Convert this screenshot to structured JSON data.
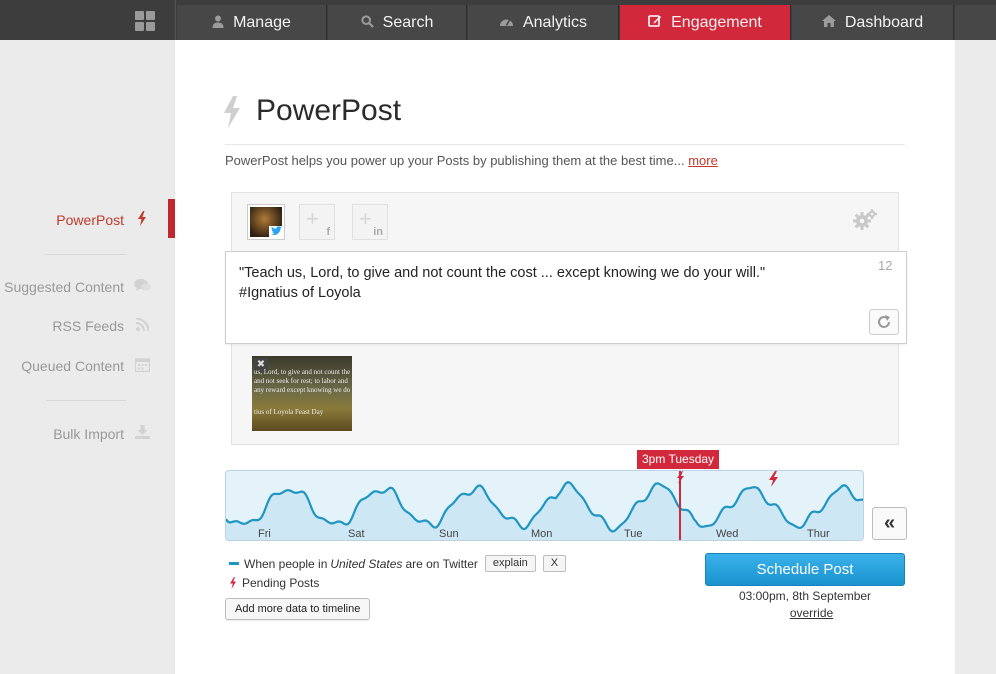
{
  "nav": {
    "tabs": [
      {
        "label": "Manage",
        "icon": "user-icon"
      },
      {
        "label": "Search",
        "icon": "search-icon"
      },
      {
        "label": "Analytics",
        "icon": "dashboard-gauge-icon"
      },
      {
        "label": "Engagement",
        "icon": "edit-icon",
        "active": true
      },
      {
        "label": "Dashboard",
        "icon": "home-icon"
      }
    ],
    "active_color": "#d2283b"
  },
  "sidebar": {
    "items": [
      {
        "label": "PowerPost",
        "icon": "bolt-icon",
        "active": true
      },
      {
        "label": "Suggested Content",
        "icon": "comments-icon"
      },
      {
        "label": "RSS Feeds",
        "icon": "rss-icon"
      },
      {
        "label": "Queued Content",
        "icon": "calendar-icon"
      },
      {
        "label": "Bulk Import",
        "icon": "download-icon"
      }
    ]
  },
  "page": {
    "title": "PowerPost",
    "intro": "PowerPost helps you power up your Posts by publishing them at the best time...",
    "more_link": "more"
  },
  "composer": {
    "networks": [
      {
        "label": "f",
        "icon": "facebook-add-icon"
      },
      {
        "label": "in",
        "icon": "linkedin-add-icon"
      }
    ],
    "text_line1": "\"Teach us, Lord, to give and not count the cost ... except knowing we do your will.\"",
    "text_line2": "#Ignatius of Loyola",
    "char_count": "12",
    "image_caption_lines": [
      "us, Lord, to give and not count the",
      "and not seek for rest; to labor and",
      "any reward except knowing we do",
      "",
      "tius of Loyola Feast Day"
    ]
  },
  "timeline": {
    "days": [
      "Fri",
      "Sat",
      "Sun",
      "Mon",
      "Tue",
      "Wed",
      "Thur"
    ],
    "now_label": "3pm Tuesday",
    "line_color": "#1f96c2",
    "marker_color": "#d2283b"
  },
  "legend": {
    "prefix": "When people in",
    "country": "United States",
    "suffix": "are on Twitter",
    "explain_btn": "explain",
    "close_btn": "X",
    "pending_label": "Pending Posts",
    "add_data_btn": "Add more data to timeline"
  },
  "schedule": {
    "button": "Schedule Post",
    "time": "03:00pm, 8th September",
    "override": "override"
  }
}
